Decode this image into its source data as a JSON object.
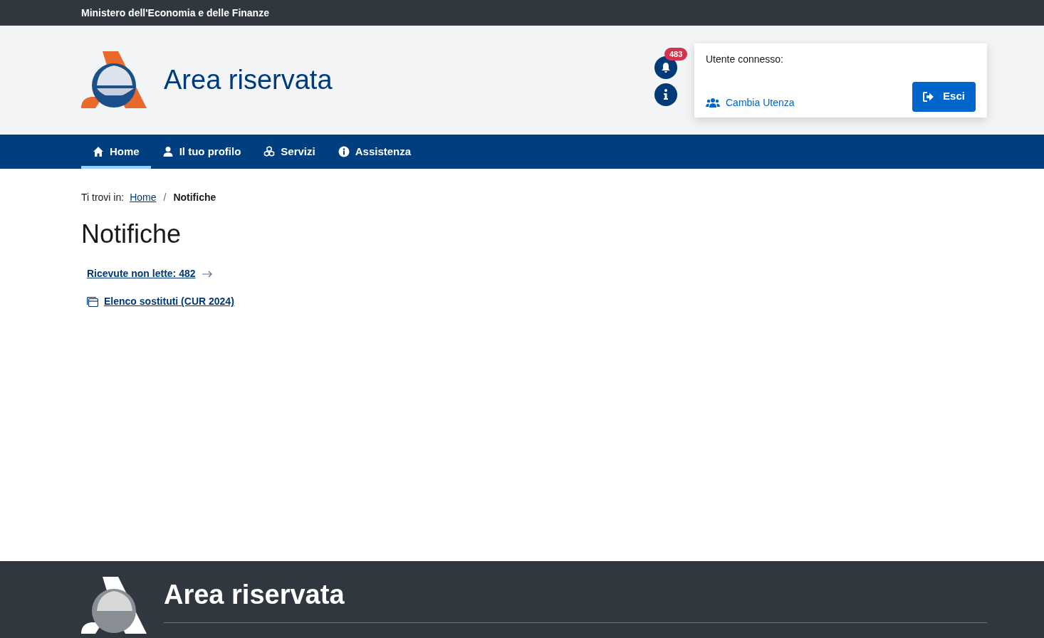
{
  "top_bar": {
    "title": "Ministero dell'Economia e delle Finanze"
  },
  "header": {
    "title": "Area riservata",
    "notifications_badge": "483",
    "user_panel": {
      "label": "Utente connesso:",
      "switch_link": "Cambia Utenza",
      "logout_button": "Esci"
    }
  },
  "nav": [
    {
      "label": "Home",
      "kind": "home",
      "selected": true
    },
    {
      "label": "Il tuo profilo",
      "kind": "user",
      "selected": false
    },
    {
      "label": "Servizi",
      "kind": "services",
      "selected": false
    },
    {
      "label": "Assistenza",
      "kind": "info",
      "selected": false
    }
  ],
  "breadcrumb": {
    "prefix": "Ti trovi in:",
    "separator": "/",
    "items": [
      {
        "label": "Home",
        "kind": "link"
      },
      {
        "label": "Notifiche",
        "kind": "current"
      }
    ]
  },
  "page_title": "Notifiche",
  "links": [
    {
      "label": "Ricevute non lette: 482",
      "kind": "arrow"
    },
    {
      "label": "Elenco sostituti (CUR 2024)",
      "kind": "window"
    }
  ],
  "footer": {
    "title": "Area riservata"
  }
}
